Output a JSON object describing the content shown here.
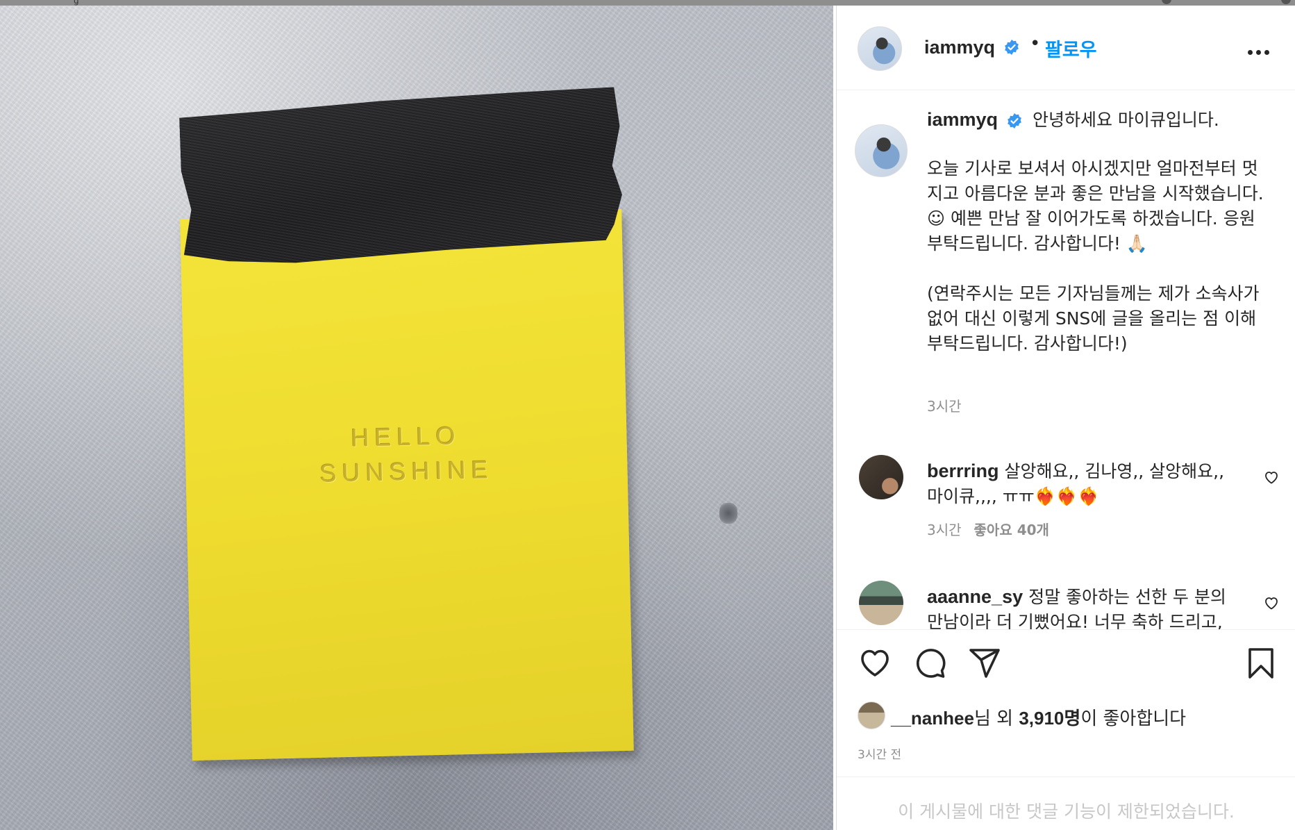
{
  "post": {
    "author": "iammyq",
    "follow_label": "팔로우",
    "separator": "•",
    "photo_text": {
      "line1": "HELLO",
      "line2": "SUNSHINE"
    }
  },
  "caption": {
    "author": "iammyq",
    "lines": [
      "안녕하세요 마이큐입니다.",
      "오늘 기사로 보셔서 아시겠지만 얼마전부터 멋",
      "지고 아름다운 분과 좋은 만남을 시작했습니다.",
      "☺ 예쁜 만남 잘 이어가도록 하겠습니다. 응원",
      "부탁드립니다. 감사합니다! 🙏🏻",
      "(연락주시는 모든 기자님들께는 제가 소속사가",
      "없어 대신 이렇게 SNS에 글을 올리는 점 이해",
      "부탁드립니다. 감사합니다!)"
    ],
    "time": "3시간"
  },
  "comments": [
    {
      "user": "berrring",
      "line1": "살앙해요,, 김나영,, 살앙해요,,",
      "line2": "마이큐,,,, ㅠㅠ❤️‍🔥❤️‍🔥❤️‍🔥",
      "time": "3시간",
      "likes": "좋아요 40개"
    },
    {
      "user": "aaanne_sy",
      "line1": "정말 좋아하는 선한 두 분의",
      "line2": "만남이라 더 기뻤어요! 너무 축하 드리고,"
    }
  ],
  "likes": {
    "user": "__nanhee",
    "suffix": "님 외 ",
    "count": "3,910명",
    "tail": "이 좋아합니다"
  },
  "time_ago": "3시간 전",
  "comments_restricted": "이 게시물에 대한 댓글 기능이 제한되었습니다.",
  "colors": {
    "link_blue": "#0095f6",
    "verified_blue": "#3897f0",
    "muted": "#8e8e8e",
    "note_yellow": "#f0dd30"
  },
  "icons": [
    "verified-badge-icon",
    "more-options-icon",
    "heart-icon",
    "comment-icon",
    "share-icon",
    "bookmark-icon"
  ]
}
